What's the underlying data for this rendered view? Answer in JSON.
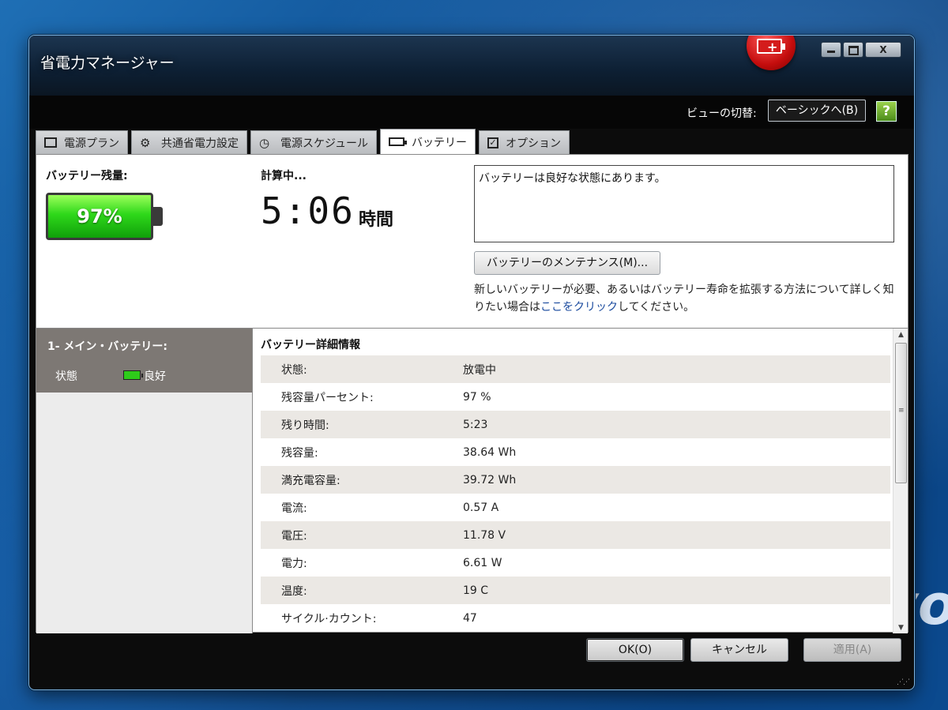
{
  "window": {
    "title": "省電力マネージャー"
  },
  "view": {
    "label": "ビューの切替:",
    "button": "ベーシックへ(B)",
    "help": "?"
  },
  "tabs": [
    {
      "label": "電源プラン",
      "icon": "document-icon"
    },
    {
      "label": "共通省電力設定",
      "icon": "gear-icon"
    },
    {
      "label": "電源スケジュール",
      "icon": "schedule-icon"
    },
    {
      "label": "バッテリー",
      "icon": "battery-icon",
      "active": true
    },
    {
      "label": "オプション",
      "icon": "checkbox-icon"
    }
  ],
  "battery": {
    "remaining_label": "バッテリー残量:",
    "percent": "97%",
    "calc_label": "計算中...",
    "time": "5:06",
    "time_unit": "時間",
    "status_message": "バッテリーは良好な状態にあります。",
    "maintenance_button": "バッテリーのメンテナンス(M)...",
    "info_prefix": "新しいバッテリーが必要、あるいはバッテリー寿命を拡張する方法について詳しく知りたい場合は",
    "info_link": "ここをクリック",
    "info_suffix": "してください。"
  },
  "main_battery": {
    "title": "1- メイン・バッテリー:",
    "state_label": "状態",
    "state_value": "良好"
  },
  "details": {
    "title": "バッテリー詳細情報",
    "rows": [
      {
        "k": "状態:",
        "v": "放電中"
      },
      {
        "k": "残容量パーセント:",
        "v": "97 %"
      },
      {
        "k": "残り時間:",
        "v": "5:23"
      },
      {
        "k": "残容量:",
        "v": "38.64 Wh"
      },
      {
        "k": "満充電容量:",
        "v": "39.72 Wh"
      },
      {
        "k": "電流:",
        "v": "0.57 A"
      },
      {
        "k": "電圧:",
        "v": "11.78 V"
      },
      {
        "k": "電力:",
        "v": "6.61 W"
      },
      {
        "k": "温度:",
        "v": "19 C"
      },
      {
        "k": "サイクル·カウント:",
        "v": "47"
      }
    ]
  },
  "footer": {
    "ok": "OK(O)",
    "cancel": "キャンセル",
    "apply": "適用(A)"
  },
  "colors": {
    "battery_green": "#2ed81a",
    "badge_red": "#c50d0d",
    "link": "#1a4a9e"
  }
}
